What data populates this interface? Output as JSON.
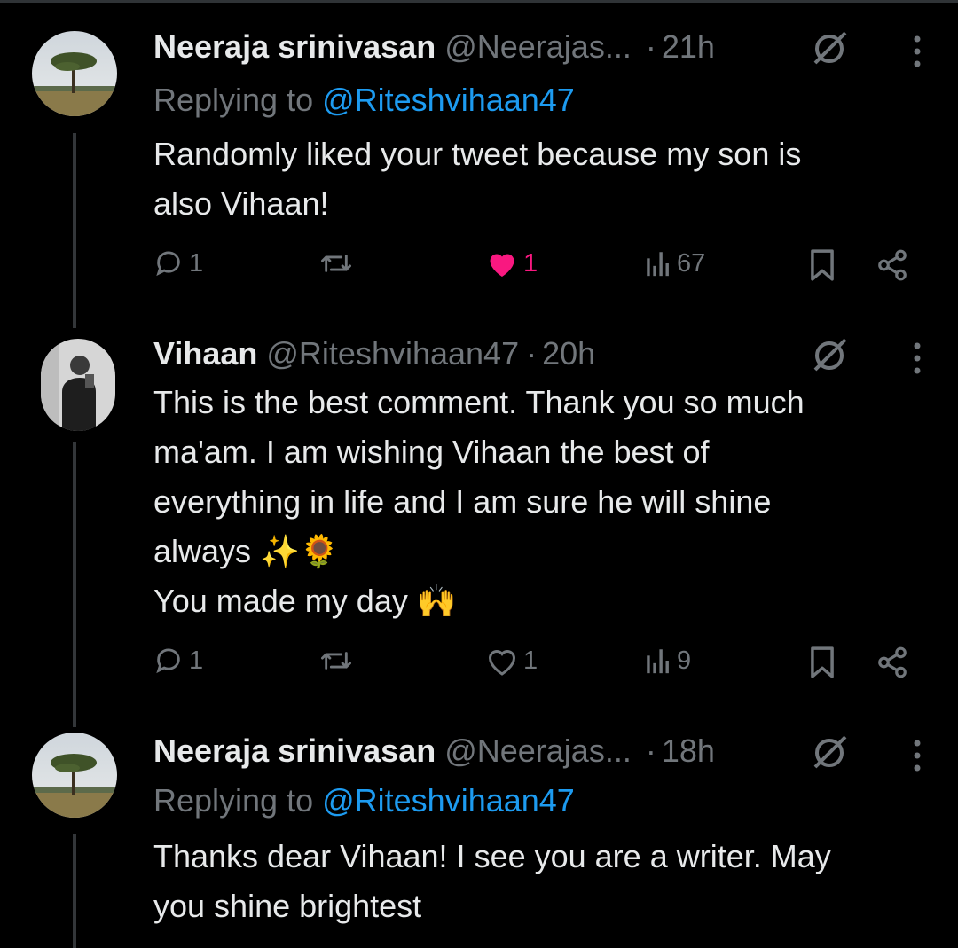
{
  "colors": {
    "background": "#000000",
    "text": "#e7e9ea",
    "muted": "#71767b",
    "link": "#1d9bf0",
    "like_active": "#f91880",
    "thread_line": "#333639"
  },
  "tweets": [
    {
      "name": "Neeraja srinivasan",
      "handle": "@Neerajas...",
      "dot": "·",
      "time": "21h",
      "replying_prefix": "Replying to ",
      "replying_mention": "@Riteshvihaan47",
      "text": "Randomly liked your tweet because my son is\nalso Vihaan!",
      "stats": {
        "replies": "1",
        "likes": "1",
        "liked": true,
        "views": "67"
      },
      "avatar": "tree-landscape-avatar"
    },
    {
      "name": "Vihaan",
      "handle": "@Riteshvihaan47",
      "dot": "·",
      "time": "20h",
      "text": "This is the best comment. Thank you so much\nma'am. I am wishing Vihaan the best of\neverything in life and I am sure he will shine\nalways ✨🌻\nYou made my day 🙌",
      "stats": {
        "replies": "1",
        "likes": "1",
        "liked": false,
        "views": "9"
      },
      "avatar": "person-photo-avatar"
    },
    {
      "name": "Neeraja srinivasan",
      "handle": "@Neerajas...",
      "dot": "·",
      "time": "18h",
      "replying_prefix": "Replying to ",
      "replying_mention": "@Riteshvihaan47",
      "text": "Thanks dear Vihaan! I see you are a writer. May\nyou shine brightest",
      "avatar": "tree-landscape-avatar"
    }
  ],
  "icons": [
    "reply-icon",
    "retweet-icon",
    "like-icon",
    "views-icon",
    "bookmark-icon",
    "share-icon",
    "grok-icon",
    "more-icon"
  ]
}
